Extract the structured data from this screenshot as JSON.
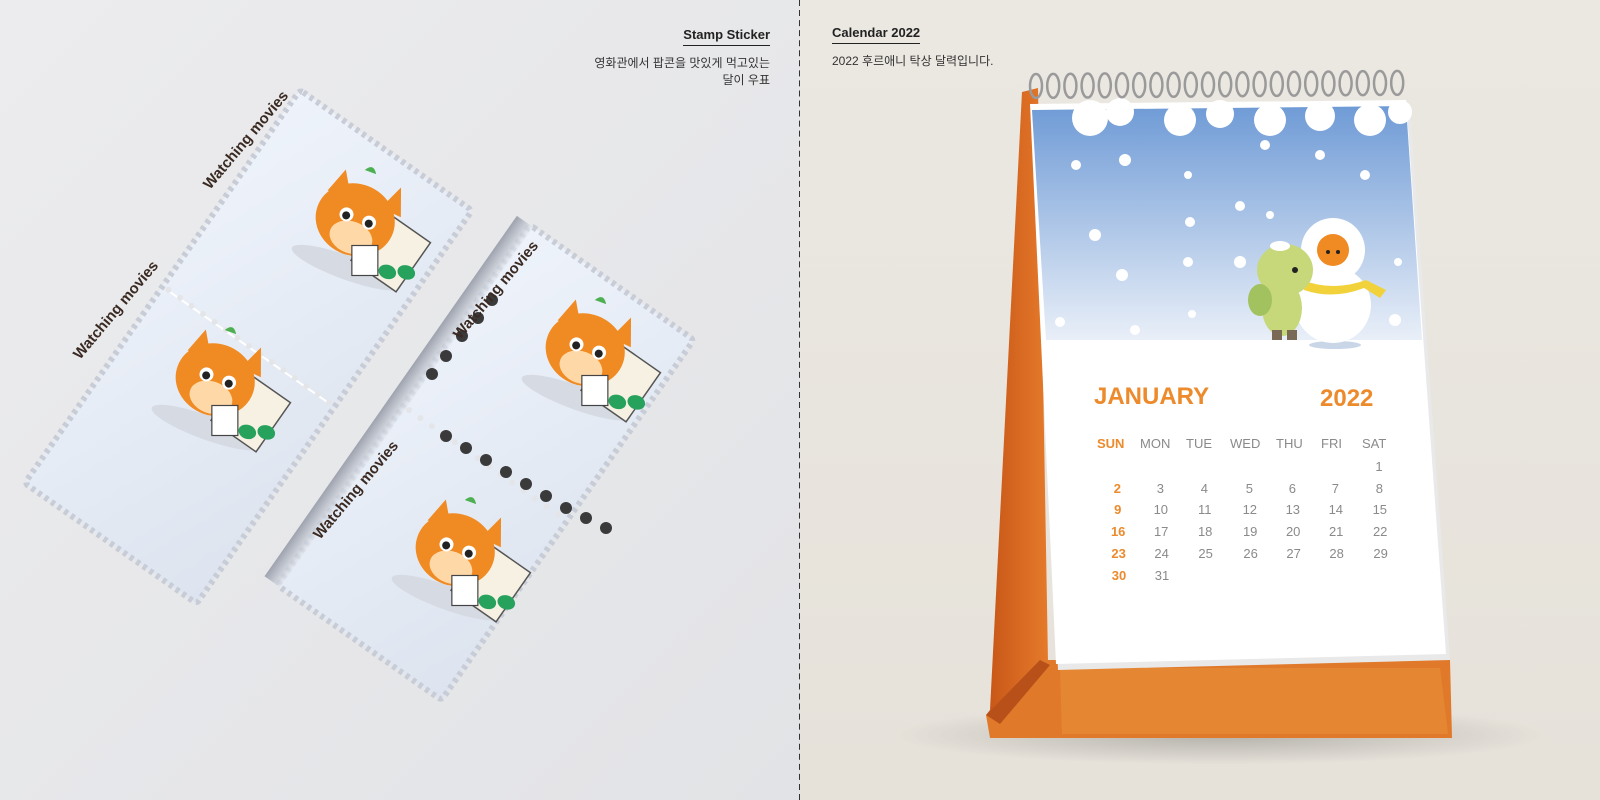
{
  "stamp": {
    "title": "Stamp Sticker",
    "desc_line1": "영화관에서 팝콘을 맛있게 먹고있는",
    "desc_line2": "달이 우표",
    "stamp_text": "Watching movies",
    "popcorn_label": "popcorn"
  },
  "calendar": {
    "title": "Calendar 2022",
    "desc": "2022 후르애니 탁상 달력입니다.",
    "month": "JANUARY",
    "year": "2022",
    "weekdays": [
      "SUN",
      "MON",
      "TUE",
      "WED",
      "THU",
      "FRI",
      "SAT"
    ],
    "weeks": [
      [
        "",
        "",
        "",
        "",
        "",
        "",
        "1"
      ],
      [
        "2",
        "3",
        "4",
        "5",
        "6",
        "7",
        "8"
      ],
      [
        "9",
        "10",
        "11",
        "12",
        "13",
        "14",
        "15"
      ],
      [
        "16",
        "17",
        "18",
        "19",
        "20",
        "21",
        "22"
      ],
      [
        "23",
        "24",
        "25",
        "26",
        "27",
        "28",
        "29"
      ],
      [
        "30",
        "31",
        "",
        "",
        "",
        "",
        ""
      ]
    ]
  },
  "colors": {
    "accent": "#ec8a2c",
    "stand": "#d9651f",
    "sky_top": "#6f9bd6"
  }
}
